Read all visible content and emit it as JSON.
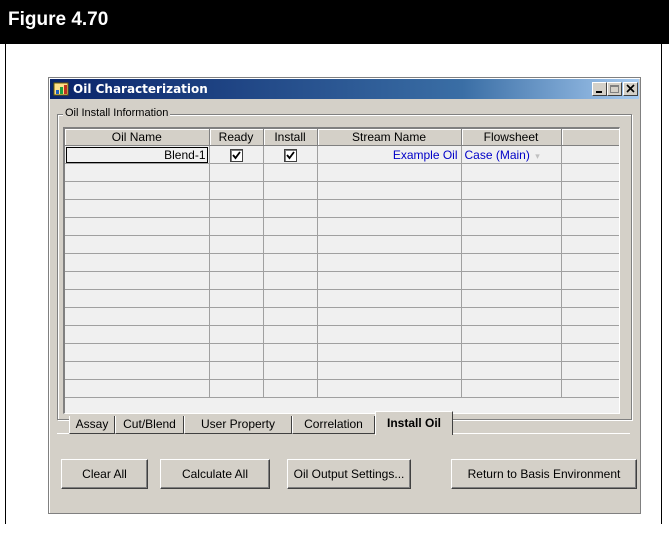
{
  "figure": {
    "title": "Figure 4.70"
  },
  "window": {
    "title": "Oil Characterization",
    "controls": {
      "minimize_icon": "minimize-icon",
      "restore_icon": "restore-icon",
      "close_icon": "close-icon"
    }
  },
  "group": {
    "label": "Oil Install Information"
  },
  "table": {
    "headers": [
      "Oil Name",
      "Ready",
      "Install",
      "Stream Name",
      "Flowsheet"
    ],
    "rows": [
      {
        "oil_name": "Blend-1",
        "ready": true,
        "install": true,
        "stream_name": "Example Oil",
        "flowsheet": "Case (Main)"
      }
    ]
  },
  "tabs": [
    {
      "label": "Assay",
      "active": false
    },
    {
      "label": "Cut/Blend",
      "active": false
    },
    {
      "label": "User Property",
      "active": false
    },
    {
      "label": "Correlation",
      "active": false
    },
    {
      "label": "Install Oil",
      "active": true
    }
  ],
  "buttons": {
    "clear_all": "Clear All",
    "calculate_all": "Calculate All",
    "oil_output_settings": "Oil Output Settings...",
    "return_to_basis": "Return to Basis Environment"
  },
  "colors": {
    "link_text": "#0000c8",
    "titlebar_start": "#0a246a",
    "titlebar_end": "#a6caf0"
  }
}
